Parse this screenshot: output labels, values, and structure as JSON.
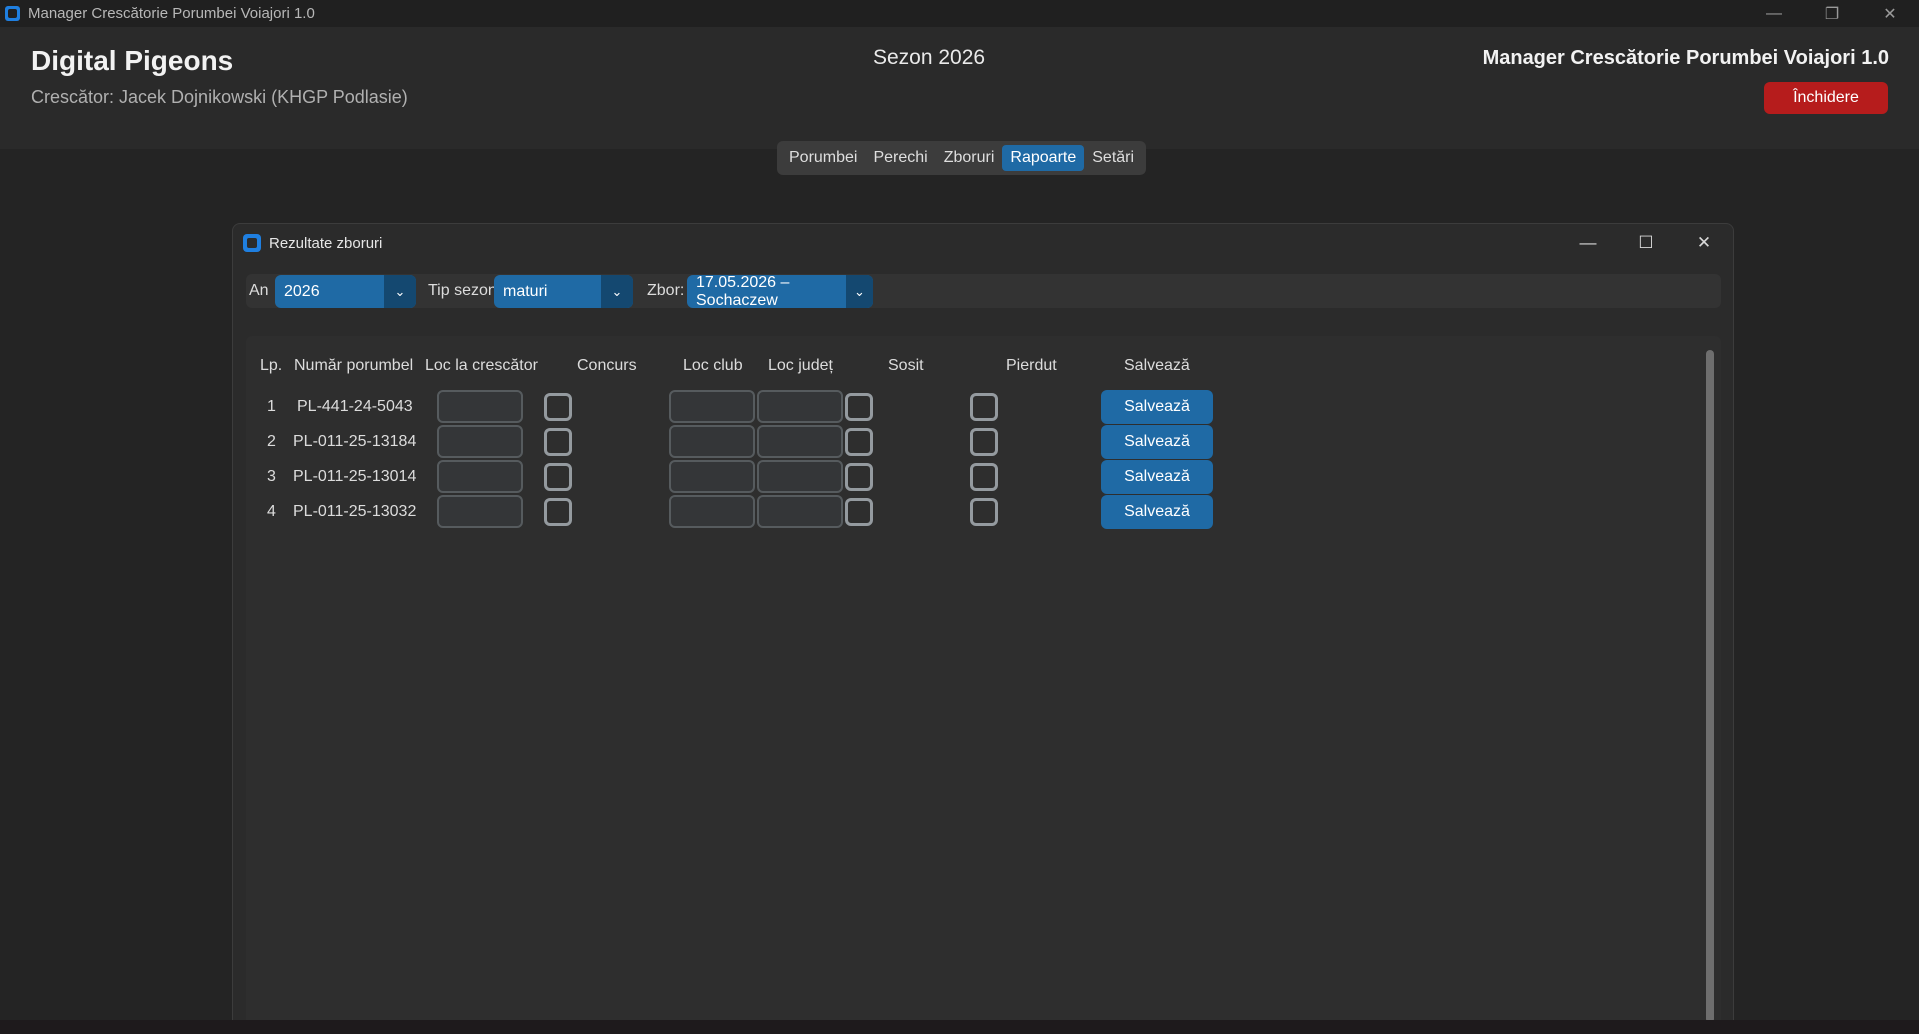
{
  "window": {
    "title": "Manager Crescătorie Porumbei Voiajori 1.0",
    "minimize": "—",
    "restore": "❐",
    "close": "✕"
  },
  "header": {
    "brand": "Digital Pigeons",
    "breeder": "Crescător: Jacek Dojnikowski (KHGP Podlasie)",
    "season": "Sezon 2026",
    "app_title": "Manager Crescătorie Porumbei Voiajori 1.0",
    "close_button": "Închidere"
  },
  "nav": {
    "tabs": [
      "Porumbei",
      "Perechi",
      "Zboruri",
      "Rapoarte",
      "Setări"
    ],
    "active": "Rapoarte"
  },
  "dialog": {
    "title": "Rezultate zboruri",
    "minimize": "—",
    "maximize": "☐",
    "close": "✕",
    "filters": {
      "year_label": "An",
      "year_value": "2026",
      "season_type_label": "Tip sezon",
      "season_type_value": "maturi",
      "flight_label": "Zbor:",
      "flight_value": "17.05.2026 – Sochaczew",
      "arrow": "⌄"
    },
    "table": {
      "headers": [
        "Lp.",
        "Număr porumbel",
        "Loc la crescător",
        "Concurs",
        "Loc club",
        "Loc județ",
        "Sosit",
        "Pierdut",
        "Salvează"
      ],
      "rows": [
        {
          "lp": "1",
          "number": "PL-441-24-5043",
          "save": "Salvează"
        },
        {
          "lp": "2",
          "number": "PL-011-25-13184",
          "save": "Salvează"
        },
        {
          "lp": "3",
          "number": "PL-011-25-13014",
          "save": "Salvează"
        },
        {
          "lp": "4",
          "number": "PL-011-25-13032",
          "save": "Salvează"
        }
      ]
    }
  },
  "colors": {
    "accent": "#1f6aa5",
    "danger": "#b61c1c",
    "background": "#242424"
  }
}
